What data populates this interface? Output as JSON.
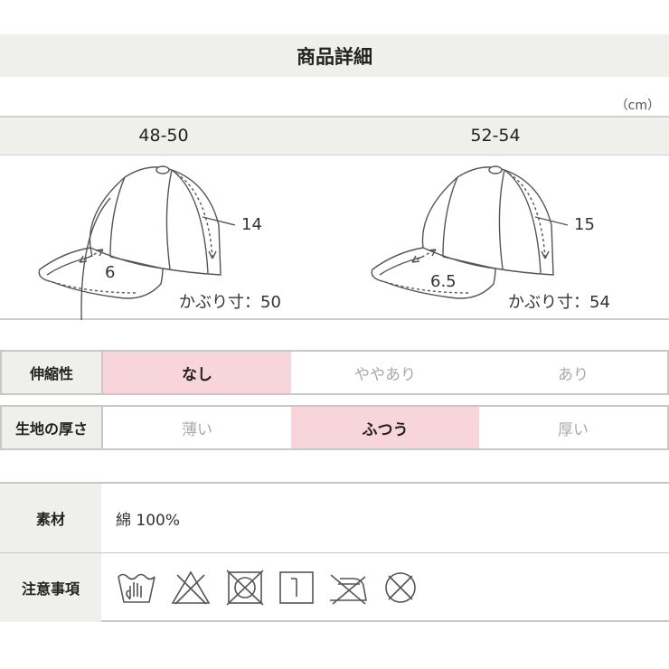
{
  "title": "商品詳細",
  "unit": "（cm）",
  "sizes": [
    {
      "name": "48-50",
      "crown_height": "14",
      "brim_length": "6",
      "head_circumference": "かぶり寸：50"
    },
    {
      "name": "52-54",
      "crown_height": "15",
      "brim_length": "6.5",
      "head_circumference": "かぶり寸：54"
    }
  ],
  "stretch": {
    "label": "伸縮性",
    "options": [
      "なし",
      "ややあり",
      "あり"
    ],
    "selected": "なし"
  },
  "thickness": {
    "label": "生地の厚さ",
    "options": [
      "薄い",
      "ふつう",
      "厚い"
    ],
    "selected": "ふつう"
  },
  "material": {
    "label": "素材",
    "value": "綿 100%"
  },
  "care": {
    "label": "注意事項",
    "icons": [
      "hand-wash-icon",
      "no-bleach-icon",
      "no-tumble-dry-icon",
      "line-dry-icon",
      "iron-low-icon",
      "no-dry-clean-icon"
    ]
  },
  "colors": {
    "highlight": "#f7d5da",
    "header_bg": "#efefeb"
  }
}
